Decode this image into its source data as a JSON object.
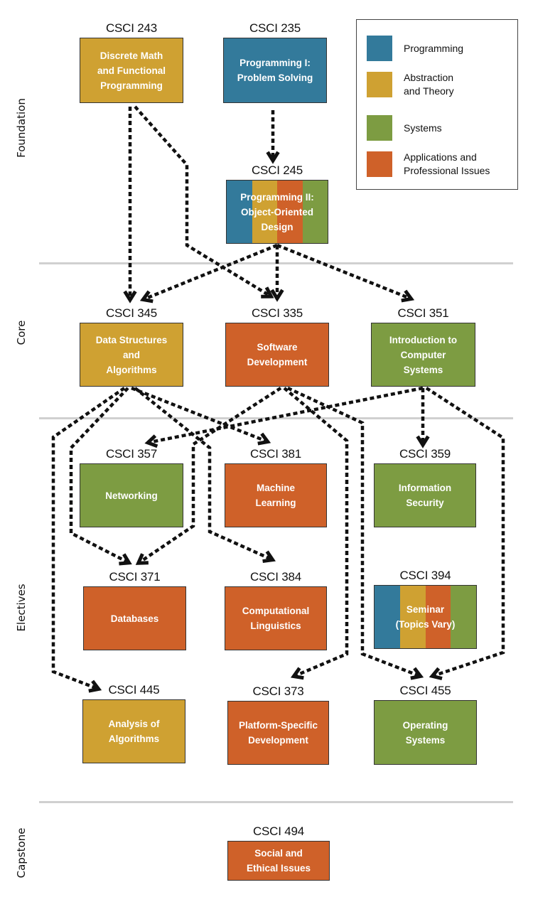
{
  "colors": {
    "programming": "#337a9b",
    "abstraction": "#cfa132",
    "systems": "#7d9c42",
    "applications": "#cf6129",
    "edge": "#111111"
  },
  "tiers": [
    {
      "id": "foundation",
      "label": "Foundation"
    },
    {
      "id": "core",
      "label": "Core"
    },
    {
      "id": "electives",
      "label": "Electives"
    },
    {
      "id": "capstone",
      "label": "Capstone"
    }
  ],
  "legend": {
    "items": [
      {
        "category": "programming",
        "label": "Programming"
      },
      {
        "category": "abstraction",
        "label": "Abstraction\nand Theory"
      },
      {
        "category": "systems",
        "label": "Systems"
      },
      {
        "category": "applications",
        "label": "Applications and\nProfessional Issues"
      }
    ]
  },
  "courses": [
    {
      "id": "csci243",
      "code": "CSCI 243",
      "title": "Discrete Math\nand Functional\nProgramming",
      "tier": "foundation",
      "categories": [
        "abstraction"
      ]
    },
    {
      "id": "csci235",
      "code": "CSCI 235",
      "title": "Programming I:\nProblem Solving",
      "tier": "foundation",
      "categories": [
        "programming"
      ]
    },
    {
      "id": "csci245",
      "code": "CSCI  245",
      "title": "Programming II:\nObject-Oriented\nDesign",
      "tier": "foundation",
      "categories": [
        "programming",
        "abstraction",
        "applications",
        "systems"
      ]
    },
    {
      "id": "csci345",
      "code": "CSCI 345",
      "title": "Data Structures\nand\nAlgorithms",
      "tier": "core",
      "categories": [
        "abstraction"
      ]
    },
    {
      "id": "csci335",
      "code": "CSCI 335",
      "title": "Software\nDevelopment",
      "tier": "core",
      "categories": [
        "applications"
      ]
    },
    {
      "id": "csci351",
      "code": "CSCI 351",
      "title": "Introduction to\nComputer\nSystems",
      "tier": "core",
      "categories": [
        "systems"
      ]
    },
    {
      "id": "csci357",
      "code": "CSCI 357",
      "title": "Networking",
      "tier": "electives",
      "categories": [
        "systems"
      ]
    },
    {
      "id": "csci381",
      "code": "CSCI 381",
      "title": "Machine\nLearning",
      "tier": "electives",
      "categories": [
        "applications"
      ]
    },
    {
      "id": "csci359",
      "code": "CSCI 359",
      "title": "Information\nSecurity",
      "tier": "electives",
      "categories": [
        "systems"
      ]
    },
    {
      "id": "csci371",
      "code": "CSCI 371",
      "title": "Databases",
      "tier": "electives",
      "categories": [
        "applications"
      ]
    },
    {
      "id": "csci384",
      "code": "CSCI 384",
      "title": "Computational\nLinguistics",
      "tier": "electives",
      "categories": [
        "applications"
      ]
    },
    {
      "id": "csci394",
      "code": "CSCI 394",
      "title": "Seminar\n(Topics Vary)",
      "tier": "electives",
      "categories": [
        "programming",
        "abstraction",
        "applications",
        "systems"
      ]
    },
    {
      "id": "csci445",
      "code": "CSCI 445",
      "title": "Analysis of\nAlgorithms",
      "tier": "electives",
      "categories": [
        "abstraction"
      ]
    },
    {
      "id": "csci373",
      "code": "CSCI 373",
      "title": "Platform-Specific\nDevelopment",
      "tier": "electives",
      "categories": [
        "applications"
      ]
    },
    {
      "id": "csci455",
      "code": "CSCI 455",
      "title": "Operating\nSystems",
      "tier": "electives",
      "categories": [
        "systems"
      ]
    },
    {
      "id": "csci494",
      "code": "CSCI 494",
      "title": "Social and\nEthical Issues",
      "tier": "capstone",
      "categories": [
        "applications"
      ]
    }
  ],
  "prerequisites": [
    {
      "from": "csci235",
      "to": "csci245"
    },
    {
      "from": "csci243",
      "to": "csci345"
    },
    {
      "from": "csci243",
      "to": "csci335"
    },
    {
      "from": "csci245",
      "to": "csci345"
    },
    {
      "from": "csci245",
      "to": "csci335"
    },
    {
      "from": "csci245",
      "to": "csci351"
    },
    {
      "from": "csci345",
      "to": "csci381"
    },
    {
      "from": "csci345",
      "to": "csci371"
    },
    {
      "from": "csci345",
      "to": "csci384"
    },
    {
      "from": "csci345",
      "to": "csci445"
    },
    {
      "from": "csci335",
      "to": "csci371"
    },
    {
      "from": "csci335",
      "to": "csci373"
    },
    {
      "from": "csci335",
      "to": "csci455"
    },
    {
      "from": "csci351",
      "to": "csci357"
    },
    {
      "from": "csci351",
      "to": "csci359"
    },
    {
      "from": "csci351",
      "to": "csci455"
    }
  ]
}
